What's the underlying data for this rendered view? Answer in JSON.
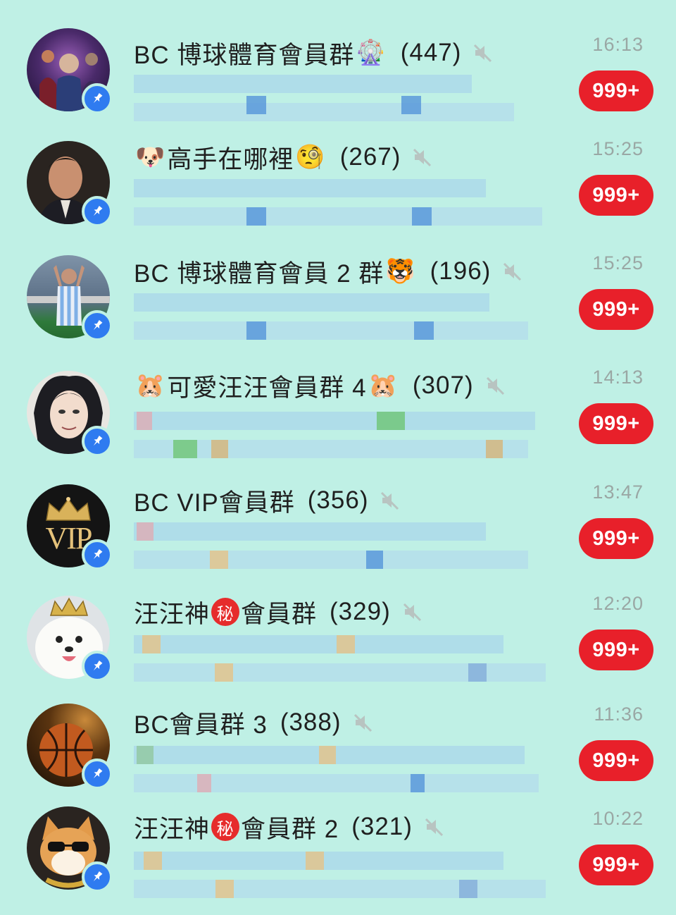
{
  "chats": [
    {
      "name": "BC 博球體育會員群",
      "emoji_after": "🎡",
      "count": "(447)",
      "time": "16:13",
      "unread": "999+",
      "avatar_icon": "superhero-group-avatar",
      "muted": true,
      "pinned": true
    },
    {
      "emoji_before": "🐶",
      "name": "高手在哪裡",
      "emoji_after": "🧐",
      "count": "(267)",
      "time": "15:25",
      "unread": "999+",
      "avatar_icon": "man-in-suit-avatar",
      "muted": true,
      "pinned": true
    },
    {
      "name": "BC 博球體育會員 2 群",
      "emoji_after": "🐯",
      "count": "(196)",
      "time": "15:25",
      "unread": "999+",
      "avatar_icon": "football-player-avatar",
      "muted": true,
      "pinned": true
    },
    {
      "emoji_before": "🐹",
      "name": "可愛汪汪會員群 4",
      "emoji_after": "🐹",
      "count": "(307)",
      "time": "14:13",
      "unread": "999+",
      "avatar_icon": "anime-character-avatar",
      "muted": true,
      "pinned": true
    },
    {
      "name": "BC VIP會員群",
      "count": "(356)",
      "time": "13:47",
      "unread": "999+",
      "avatar_icon": "vip-crown-avatar",
      "avatar_text": "VIP",
      "muted": true,
      "pinned": true
    },
    {
      "name_part1": "汪汪神",
      "secret": "秘",
      "name_part2": "會員群",
      "count": "(329)",
      "time": "12:20",
      "unread": "999+",
      "avatar_icon": "white-dog-crown-avatar",
      "muted": true,
      "pinned": true
    },
    {
      "name": "BC會員群 3",
      "count": "(388)",
      "time": "11:36",
      "unread": "999+",
      "avatar_icon": "basketball-avatar",
      "muted": true,
      "pinned": true
    },
    {
      "name_part1": "汪汪神",
      "secret": "秘",
      "name_part2": "會員群 2",
      "count": "(321)",
      "time": "10:22",
      "unread": "999+",
      "avatar_icon": "shiba-sunglasses-avatar",
      "muted": true,
      "pinned": true
    }
  ],
  "colors": {
    "background": "#bff0e5",
    "badge": "#e8202a",
    "pin": "#2f7bf0",
    "time": "#9aa7a4"
  }
}
